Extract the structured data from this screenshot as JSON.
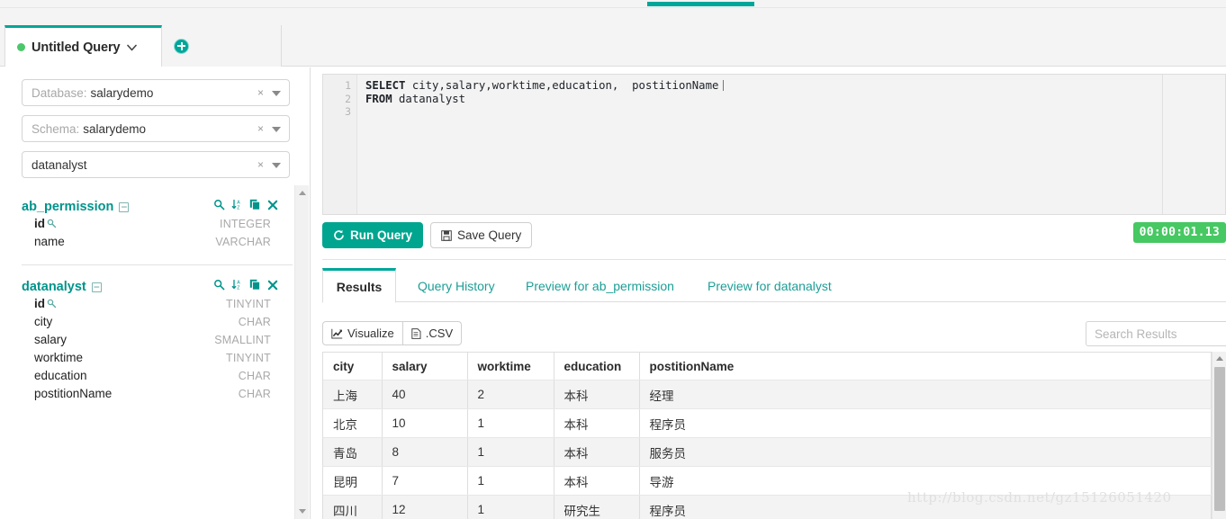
{
  "window": {
    "accent_color": "#00a699"
  },
  "tabbar": {
    "query_tab_label": "Untitled Query",
    "query_tab_caret": "⌄",
    "status_dot_color": "#4cc76a",
    "add_tab_label": "new-query-tab"
  },
  "sidebar": {
    "selectors": [
      {
        "label": "Database:",
        "value": "salarydemo",
        "clear": "×"
      },
      {
        "label": "Schema:",
        "value": "salarydemo",
        "clear": "×"
      },
      {
        "label": "",
        "value": "datanalyst",
        "clear": "×"
      }
    ],
    "tables": [
      {
        "name": "ab_permission",
        "collapse": "−",
        "columns": [
          {
            "name": "id",
            "type": "INTEGER",
            "primary_key": true
          },
          {
            "name": "name",
            "type": "VARCHAR",
            "primary_key": false
          }
        ]
      },
      {
        "name": "datanalyst",
        "collapse": "−",
        "columns": [
          {
            "name": "id",
            "type": "TINYINT",
            "primary_key": true
          },
          {
            "name": "city",
            "type": "CHAR",
            "primary_key": false
          },
          {
            "name": "salary",
            "type": "SMALLINT",
            "primary_key": false
          },
          {
            "name": "worktime",
            "type": "TINYINT",
            "primary_key": false
          },
          {
            "name": "education",
            "type": "CHAR",
            "primary_key": false
          },
          {
            "name": "postitionName",
            "type": "CHAR",
            "primary_key": false
          }
        ]
      }
    ],
    "table_icons": [
      "search-icon",
      "sort-alpha-icon",
      "copy-icon",
      "close-icon"
    ]
  },
  "editor": {
    "line_numbers": [
      "1",
      "2",
      "3"
    ],
    "line1_keyword": "SELECT",
    "line1_rest": " city,salary,worktime,education,  postitionName",
    "line2_keyword": "FROM",
    "line2_rest": " datanalyst",
    "line3": ""
  },
  "actions": {
    "run_label": "Run Query",
    "save_label": "Save Query",
    "timer": "00:00:01.13",
    "timer_color": "#46c862"
  },
  "result_tabs": [
    {
      "label": "Results",
      "active": true
    },
    {
      "label": "Query History",
      "active": false
    },
    {
      "label": "Preview for ab_permission",
      "active": false
    },
    {
      "label": "Preview for datanalyst",
      "active": false
    }
  ],
  "result_toolbar": {
    "visualize_label": "Visualize",
    "csv_label": ".CSV",
    "search_placeholder": "Search Results",
    "search_value": ""
  },
  "results_table": {
    "columns": [
      "city",
      "salary",
      "worktime",
      "education",
      "postitionName"
    ],
    "rows": [
      [
        "上海",
        "40",
        "2",
        "本科",
        "经理"
      ],
      [
        "北京",
        "10",
        "1",
        "本科",
        "程序员"
      ],
      [
        "青岛",
        "8",
        "1",
        "本科",
        "服务员"
      ],
      [
        "昆明",
        "7",
        "1",
        "本科",
        "导游"
      ],
      [
        "四川",
        "12",
        "1",
        "研究生",
        "程序员"
      ]
    ]
  },
  "watermark": {
    "text": "http://blog.csdn.net/gz15126051420"
  }
}
